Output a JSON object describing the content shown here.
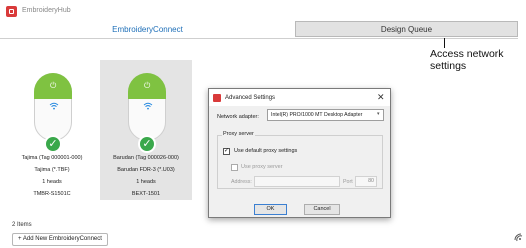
{
  "window": {
    "title": "EmbroideryHub"
  },
  "tabs": [
    {
      "label": "EmbroideryConnect",
      "active": true
    },
    {
      "label": "Design Queue",
      "active": false
    }
  ],
  "callout": {
    "text": "Access network settings"
  },
  "machines": [
    {
      "name_line": "Tajima  (Tag 000001-000)",
      "format": "Tajima (*.TBF)",
      "heads": "1 heads",
      "model": "TMBR-S1501C",
      "status": "connected",
      "selected": false
    },
    {
      "name_line": "Barudan  (Tag 000026-000)",
      "format": "Barudan FDR-3 (*.U03)",
      "heads": "1 heads",
      "model": "BEXT-1501",
      "status": "connected",
      "selected": true
    }
  ],
  "footer": {
    "items_count": "2 Items",
    "add_button": "+ Add New EmbroideryConnect"
  },
  "dialog": {
    "title": "Advanced Settings",
    "close": "✕",
    "network_adapter_label": "Network adapter:",
    "network_adapter_value": "Intel(R) PRO/1000 MT Desktop Adapter",
    "proxy_group_label": "Proxy server",
    "use_default_label": "Use default proxy settings",
    "use_default_checked": true,
    "use_proxy_label": "Use proxy server",
    "use_proxy_checked": false,
    "address_label": "Address:",
    "address_value": "",
    "port_label": "Port",
    "port_value": "80",
    "ok": "OK",
    "cancel": "Cancel"
  },
  "colors": {
    "accent": "#1e6fb8",
    "status_green": "#3aa84b",
    "pill_green": "#7fc241",
    "brand_red": "#d93a3a"
  },
  "icons": {
    "app": "app-logo-icon",
    "power": "power-icon",
    "wifi": "wifi-icon",
    "check": "check-icon",
    "close": "close-icon",
    "chevron": "chevron-down-icon"
  }
}
